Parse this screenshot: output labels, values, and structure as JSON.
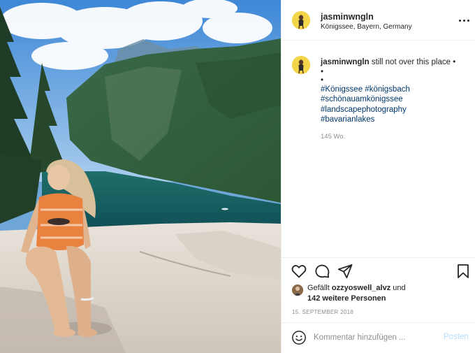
{
  "post": {
    "username": "jasminwngln",
    "location": "Königssee, Bayern, Germany",
    "photo_description_icon": "lake-mountain-photo",
    "caption": {
      "username": "jasminwngln",
      "text": "still not over this place •",
      "bullets": [
        "•",
        "•"
      ],
      "hashtags": [
        "#Königssee #königsbach",
        "#schönauamkönigssee",
        "#landscapephotography",
        "#bavarianlakes"
      ],
      "age": "145 Wo."
    },
    "likes": {
      "prefix": "Gefällt",
      "user": "ozzyoswell_alvz",
      "suffix": "und",
      "others": "142 weitere Personen"
    },
    "date": "15. SEPTEMBER 2018"
  },
  "comment": {
    "placeholder": "Kommentar hinzufügen ...",
    "post_label": "Posten"
  },
  "icons": {
    "more": "more-horizontal-icon",
    "like": "heart-icon",
    "comment": "comment-bubble-icon",
    "share": "paper-plane-icon",
    "save": "bookmark-icon",
    "emoji": "smiley-icon"
  },
  "colors": {
    "hashtag": "#00376b",
    "muted": "#8e8e8e",
    "post_button_disabled": "#b2dffc",
    "avatar_bg": "#f4d64a"
  }
}
